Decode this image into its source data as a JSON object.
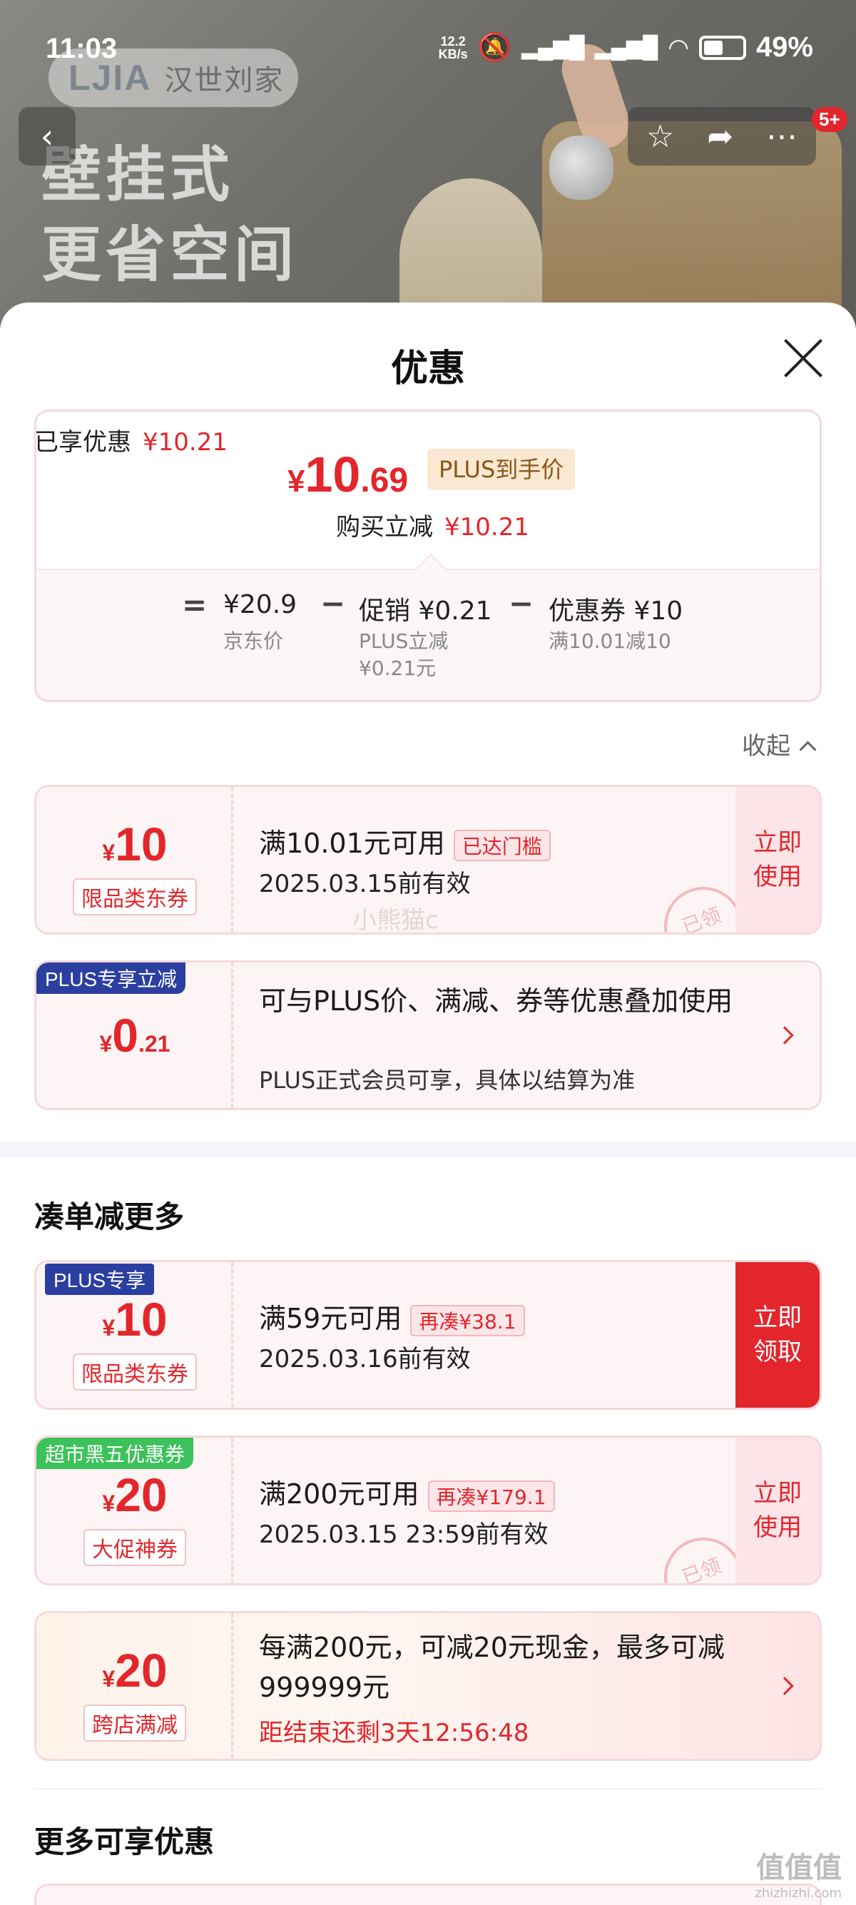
{
  "status_bar": {
    "time": "11:03",
    "netspeed_value": "12.2",
    "netspeed_unit": "KB/s",
    "battery": "49%"
  },
  "hero": {
    "brand_logo": "LJIA",
    "brand_name": "汉世刘家",
    "slogan_line1": "壁挂式",
    "slogan_line2": "更省空间",
    "badge": "5+"
  },
  "sheet": {
    "title": "优惠"
  },
  "price_summary": {
    "currency": "¥",
    "price_int": "10",
    "price_dec": ".69",
    "plus_tag": "PLUS到手价",
    "reduce_label": "购买立减",
    "reduce_value": "¥10.21",
    "eq": "=",
    "minus": "−",
    "jd_price": "¥20.9",
    "jd_label": "京东价",
    "promo": "促销 ¥0.21",
    "promo_sub1": "PLUS立减",
    "promo_sub2": "¥0.21元",
    "coupon": "优惠券 ¥10",
    "coupon_sub": "满10.01减10"
  },
  "enjoyed": {
    "label": "已享优惠",
    "value": "¥10.21",
    "collapse": "收起"
  },
  "coupons_enjoyed": [
    {
      "currency": "¥",
      "amount": "10",
      "type": "限品类东券",
      "title": "满10.01元可用",
      "tag": "已达门槛",
      "date": "2025.03.15前有效",
      "cta_line1": "立即",
      "cta_line2": "使用",
      "stamp": "已领"
    },
    {
      "ribbon": "PLUS专享立减",
      "currency": "¥",
      "amount": "0",
      "amount_dec": ".21",
      "desc": "可与PLUS价、满减、券等优惠叠加使用",
      "note": "PLUS正式会员可享，具体以结算为准"
    }
  ],
  "watermark_text": "小熊猫c",
  "section_more": {
    "title": "凑单减更多"
  },
  "coupons_more": [
    {
      "ribbon": "PLUS专享",
      "currency": "¥",
      "amount": "10",
      "type": "限品类东券",
      "title": "满59元可用",
      "tag": "再凑¥38.1",
      "date": "2025.03.16前有效",
      "cta_line1": "立即",
      "cta_line2": "领取"
    },
    {
      "ribbon": "超市黑五优惠券",
      "currency": "¥",
      "amount": "20",
      "type": "大促神券",
      "title": "满200元可用",
      "tag": "再凑¥179.1",
      "date": "2025.03.15 23:59前有效",
      "cta_line1": "立即",
      "cta_line2": "使用",
      "stamp": "已领"
    },
    {
      "currency": "¥",
      "amount": "20",
      "type": "跨店满减",
      "desc": "每满200元，可减20元现金，最多可减999999元",
      "countdown": "距结束还剩3天12:56:48"
    }
  ],
  "section_extra": {
    "title": "更多可享优惠"
  },
  "site_watermark": {
    "main": "值值值",
    "sub": "zhizhizhi.com"
  }
}
